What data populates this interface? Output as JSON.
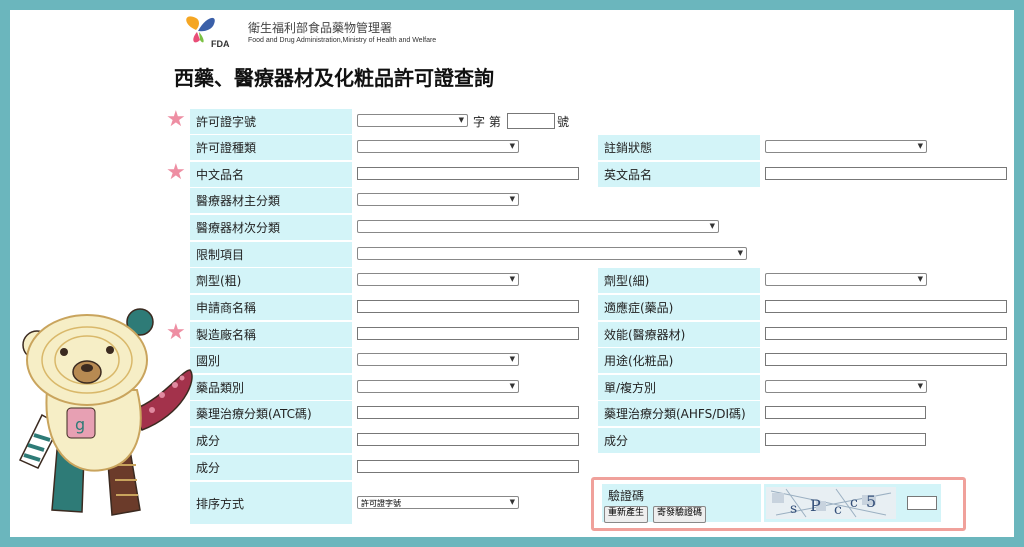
{
  "header": {
    "logo_abbr": "FDA",
    "agency_zh": "衛生福利部食品藥物管理署",
    "agency_en": "Food and Drug Administration,Ministry of Health and Welfare"
  },
  "page_title": "西藥、醫療器材及化粧品許可證查詢",
  "license_row": {
    "label": "許可證字號",
    "zi": "字 第",
    "hao": "號"
  },
  "rows": {
    "license_type": "許可證種類",
    "cancel_status": "註銷狀態",
    "chinese_name": "中文品名",
    "english_name": "英文品名",
    "device_main_category": "醫療器材主分類",
    "device_sub_category": "醫療器材次分類",
    "restriction": "限制項目",
    "dosage_form_coarse": "劑型(粗)",
    "dosage_form_fine": "劑型(細)",
    "applicant_name": "申請商名稱",
    "indication": "適應症(藥品)",
    "manufacturer_name": "製造廠名稱",
    "device_efficacy": "效能(醫療器材)",
    "country": "國別",
    "cosmetic_use": "用途(化粧品)",
    "drug_category": "藥品類別",
    "single_compound": "單/複方別",
    "atc_class": "藥理治療分類(ATC碼)",
    "ahfs_class": "藥理治療分類(AHFS/DI碼)",
    "ingredient_1": "成分",
    "ingredient_2": "成分",
    "ingredient_3": "成分",
    "sort_order": "排序方式"
  },
  "sort_select_value": "許可證字號",
  "captcha": {
    "label": "驗證碼",
    "regenerate_button": "重新產生",
    "send_button": "寄發驗證碼",
    "image_text": "sPcc5"
  },
  "colors": {
    "frame_border": "#6bb6bd",
    "label_bg": "#d3f4f8",
    "star": "#ee8ea3",
    "captcha_outline": "#f0a19b"
  },
  "icons": [
    "star-icon",
    "fda-butterfly-logo",
    "bear-mascot-illustration",
    "dropdown-caret-icon"
  ]
}
